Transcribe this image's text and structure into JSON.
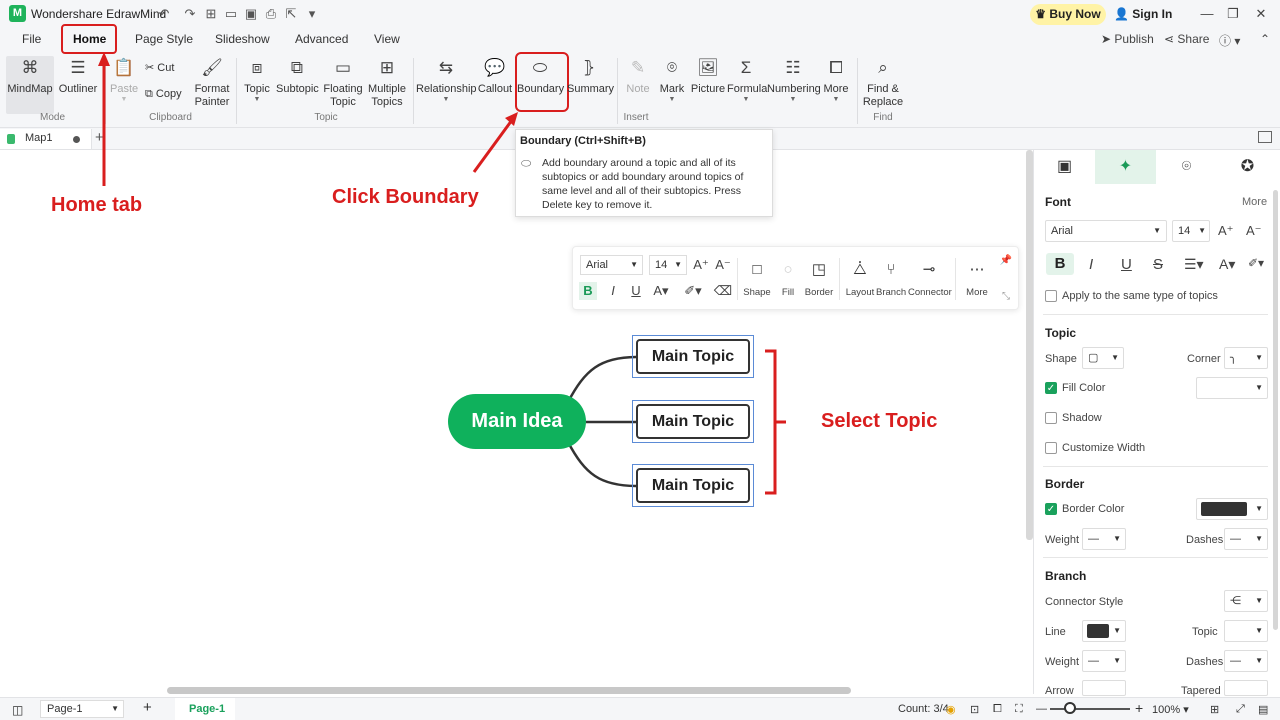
{
  "window": {
    "app_title": "Wondershare EdrawMind",
    "buy_now": "Buy Now",
    "sign_in": "Sign In"
  },
  "menu": {
    "tabs": [
      "File",
      "Home",
      "Page Style",
      "Slideshow",
      "Advanced",
      "View"
    ],
    "active_tab": "Home",
    "publish": "Publish",
    "share": "Share"
  },
  "ribbon": {
    "mode": {
      "mindmap": "MindMap",
      "outliner": "Outliner",
      "group": "Mode"
    },
    "clipboard": {
      "paste": "Paste",
      "cut": "Cut",
      "copy": "Copy",
      "format_painter_1": "Format",
      "format_painter_2": "Painter",
      "group": "Clipboard"
    },
    "topic": {
      "topic": "Topic",
      "subtopic": "Subtopic",
      "floating_1": "Floating",
      "floating_2": "Topic",
      "multiple_1": "Multiple",
      "multiple_2": "Topics",
      "group": "Topic"
    },
    "insert": {
      "relationship": "Relationship",
      "callout": "Callout",
      "boundary": "Boundary",
      "summary": "Summary",
      "note": "Note",
      "mark": "Mark",
      "picture": "Picture",
      "formula": "Formula",
      "numbering": "Numbering",
      "more": "More",
      "group": "Insert"
    },
    "find": {
      "find_1": "Find &",
      "find_2": "Replace",
      "group": "Find"
    }
  },
  "doc_tab": {
    "name": "Map1"
  },
  "tooltip": {
    "title": "Boundary (Ctrl+Shift+B)",
    "body": "Add boundary around a topic and all of its subtopics or add boundary around topics of same level and all of their subtopics. Press Delete key to remove it."
  },
  "floating_toolbar": {
    "font": "Arial",
    "size": "14",
    "tools": [
      "Shape",
      "Fill",
      "Border",
      "Layout",
      "Branch",
      "Connector",
      "More"
    ]
  },
  "mindmap": {
    "main_idea": "Main Idea",
    "topics": [
      "Main Topic",
      "Main Topic",
      "Main Topic"
    ]
  },
  "annotations": {
    "home_tab": "Home tab",
    "click_boundary": "Click Boundary",
    "select_topic": "Select Topic",
    "color": "#d91e1e"
  },
  "right_panel": {
    "font_header": "Font",
    "more": "More",
    "font_name": "Arial",
    "font_size": "14",
    "apply_same": "Apply to the same type of topics",
    "topic_header": "Topic",
    "shape": "Shape",
    "corner": "Corner",
    "fill_color": "Fill Color",
    "shadow": "Shadow",
    "customize_width": "Customize Width",
    "border_header": "Border",
    "border_color": "Border Color",
    "weight": "Weight",
    "dashes": "Dashes",
    "branch_header": "Branch",
    "connector_style": "Connector Style",
    "line": "Line",
    "topic": "Topic",
    "weight2": "Weight",
    "dashes2": "Dashes",
    "arrow": "Arrow",
    "tapered": "Tapered"
  },
  "status": {
    "page_select": "Page-1",
    "page_tab": "Page-1",
    "count": "Count: 3/4",
    "zoom": "100%"
  },
  "colors": {
    "brand_green": "#0fb15c",
    "accent_yellow": "#fff3a6"
  }
}
